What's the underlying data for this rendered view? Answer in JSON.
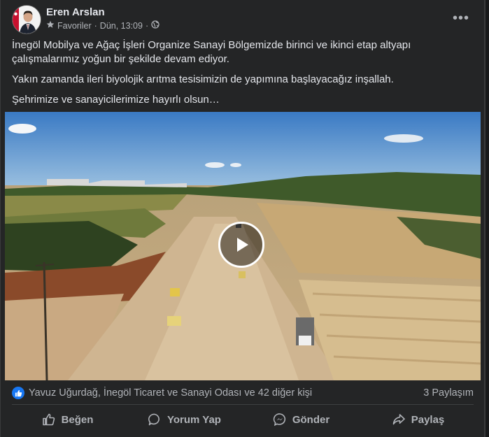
{
  "post": {
    "author": "Eren Arslan",
    "favorites": "Favoriler",
    "separator": "·",
    "time": "Dün, 13:09",
    "separator2": "·",
    "more": "•••",
    "paragraphs": [
      "İnegöl Mobilya ve Ağaç İşleri Organize Sanayi Bölgemizde birinci ve ikinci etap altyapı çalışmalarımız yoğun bir şekilde devam ediyor.",
      "Yakın zamanda ileri biyolojik arıtma tesisimizin de yapımına başlayacağız inşallah.",
      "Şehrimize ve sanayicilerimize hayırlı olsun…"
    ]
  },
  "reactions": {
    "summary": "Yavuz Uğurdağ, İnegöl Ticaret ve Sanayi Odası ve 42 diğer kişi",
    "shares": "3 Paylaşım"
  },
  "actions": {
    "like": "Beğen",
    "comment": "Yorum Yap",
    "send": "Gönder",
    "share": "Paylaş"
  },
  "colors": {
    "background": "#242526",
    "text": "#e4e6eb",
    "secondary": "#b0b3b8",
    "accent": "#1877f2"
  },
  "icons": {
    "favorite": "star-icon",
    "privacy": "globe-icon",
    "play": "play-icon",
    "like": "thumbs-up-icon",
    "comment": "comment-icon",
    "send": "messenger-icon",
    "share": "share-arrow-icon"
  }
}
